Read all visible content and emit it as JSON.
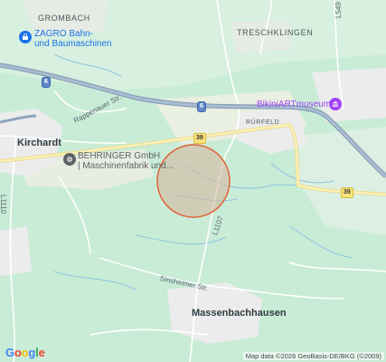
{
  "map": {
    "places": {
      "grombach": "GROMBACH",
      "treschklingen": "TRESCHKLINGEN",
      "kirchardt": "Kirchardt",
      "rurfeld": "RÜRFELD",
      "massenbachhausen": "Massenbachhausen"
    },
    "streets": {
      "rappenauer": "Rappenauer Str.",
      "sinsheimer": "Sinsheimer Str.",
      "l1110": "L1110",
      "l1107": "L1107",
      "l549": "L549"
    },
    "shields": {
      "a6_west": "6",
      "a6_east": "6",
      "b39_west": "39",
      "b39_east": "39"
    },
    "pois": {
      "zagro": {
        "line1": "ZAGRO Bahn-",
        "line2": "und Baumaschinen",
        "color": "#1a73e8",
        "icon": "shopping-bag-icon"
      },
      "behringer": {
        "line1": "BEHRINGER GmbH",
        "line2": "| Maschinenfabrik und...",
        "color": "#5f6368",
        "icon": "industry-icon"
      },
      "bikini": {
        "line1": "BikiniARTmuseum",
        "color": "#a142f4",
        "icon": "museum-icon"
      }
    },
    "overlay": {
      "fill": "#d6b9a0",
      "stroke": "#e0623a"
    },
    "logo": "Google",
    "attribution": "Map data ©2026 GeoBasis-DE/BKG (©2009)"
  }
}
